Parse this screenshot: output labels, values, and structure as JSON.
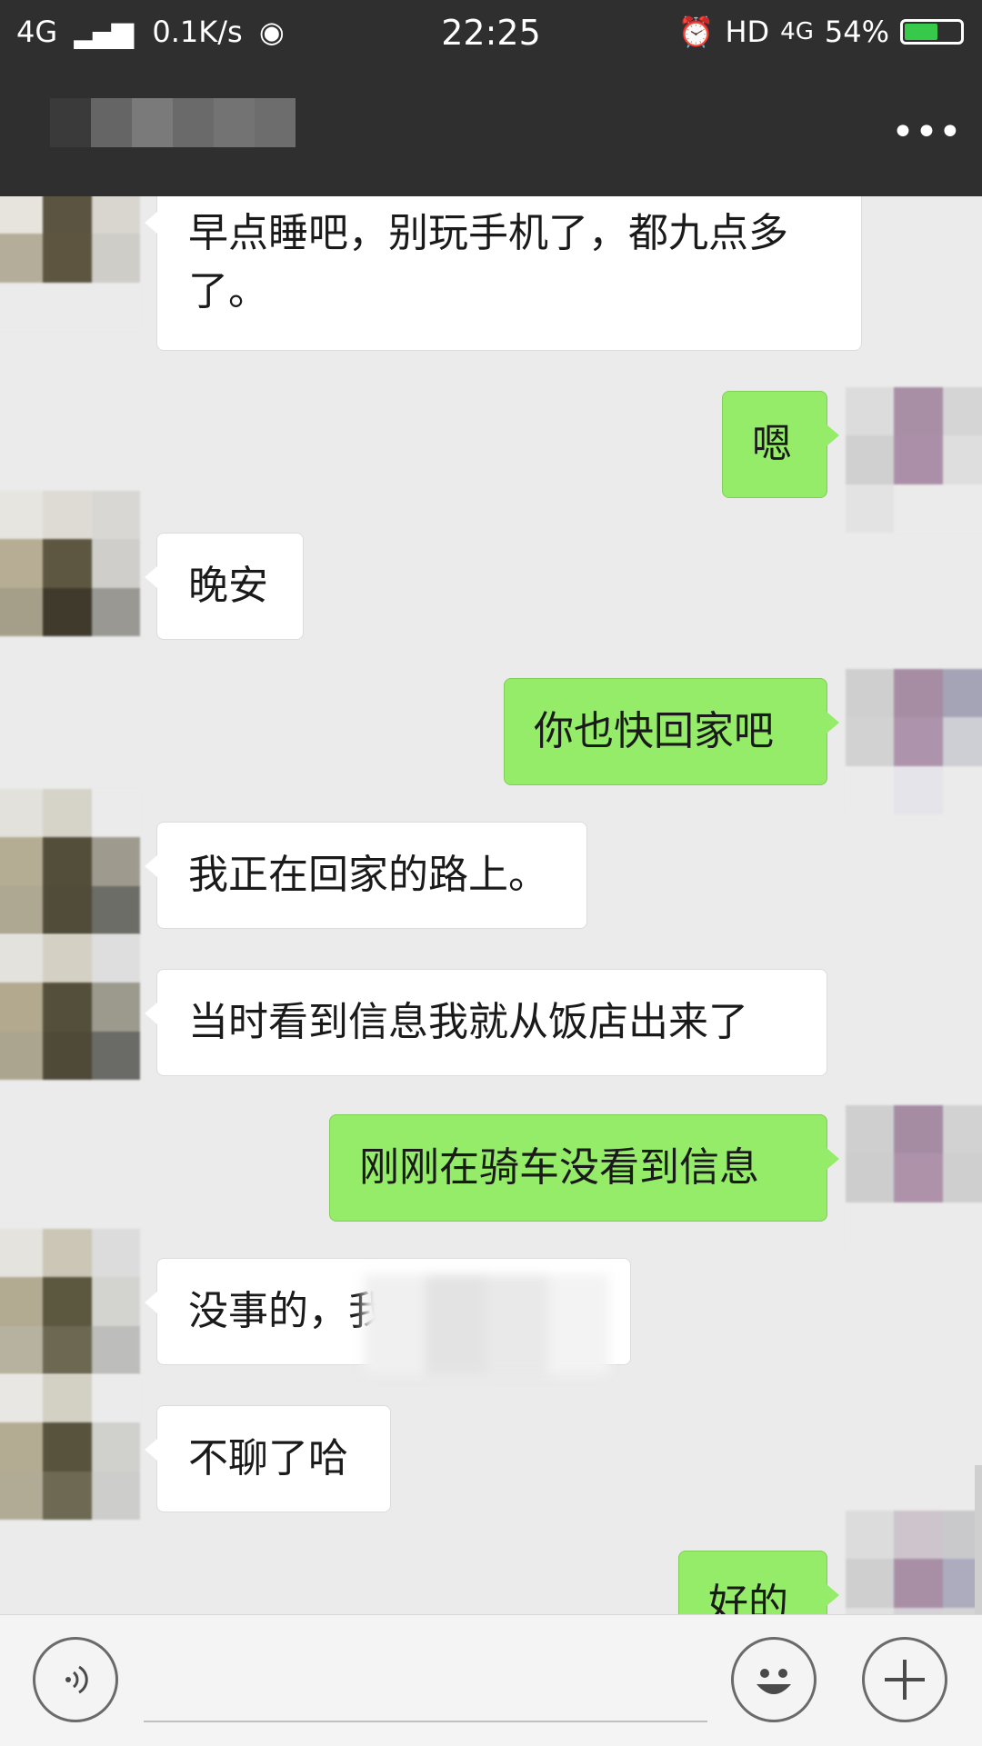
{
  "status_bar": {
    "network": "4G",
    "signal": "▐▐▐",
    "speed": "0.1K/s",
    "time": "22:25",
    "hd": "HD",
    "network2": "4G",
    "battery": "54%"
  },
  "header": {
    "title": "",
    "more_label": "•••"
  },
  "messages": [
    {
      "side": "in",
      "text": "早点睡吧，别玩手机了，都九点多了。"
    },
    {
      "side": "out",
      "text": "嗯"
    },
    {
      "side": "in",
      "text": "晚安"
    },
    {
      "side": "out",
      "text": "你也快回家吧"
    },
    {
      "side": "in",
      "text": "我正在回家的路上。"
    },
    {
      "side": "in",
      "text": "当时看到信息我就从饭店出来了"
    },
    {
      "side": "out",
      "text": "刚刚在骑车没看到信息"
    },
    {
      "side": "in",
      "text": "没事的，我"
    },
    {
      "side": "in",
      "text": "不聊了哈"
    },
    {
      "side": "out",
      "text": "好的"
    }
  ],
  "input_bar": {
    "voice_icon": "voice-icon",
    "emoji_icon": "emoji-icon",
    "plus_icon": "plus-icon",
    "plus_label": "+",
    "emoji_label": "☺"
  },
  "colors": {
    "header_bg": "#2f2f2f",
    "chat_bg": "#ebebeb",
    "out_bubble": "#95ec69",
    "in_bubble": "#ffffff"
  }
}
